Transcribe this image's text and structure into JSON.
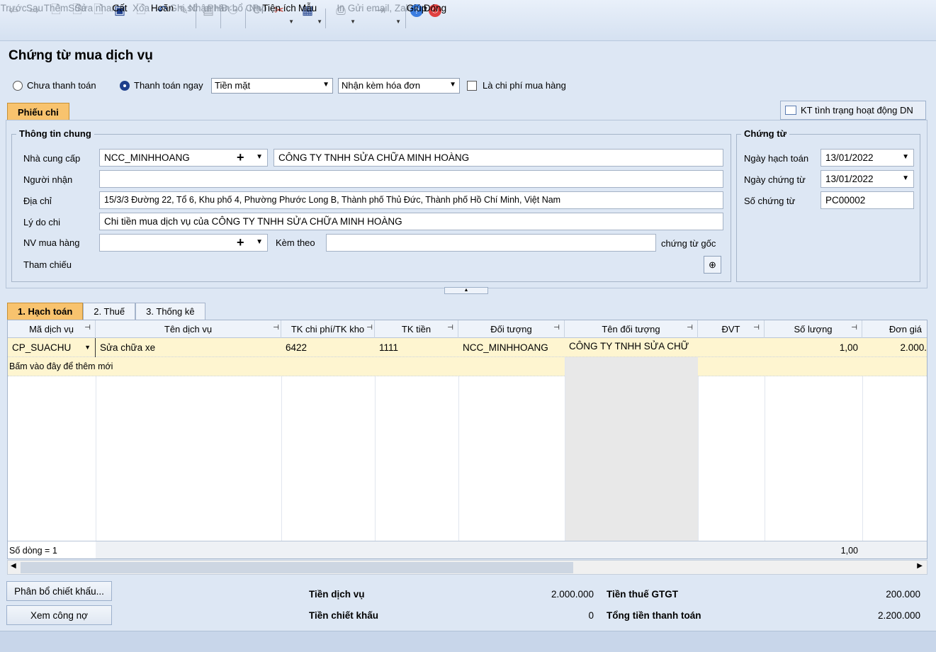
{
  "toolbar": {
    "buttons": [
      {
        "label": "Trước",
        "icon": "arrow-left-icon"
      },
      {
        "label": "Sau",
        "icon": "arrow-right-icon"
      },
      {
        "label": "Thêm",
        "icon": "add-doc-icon"
      },
      {
        "label": "Sửa",
        "icon": "edit-doc-icon"
      },
      {
        "label": "Sửa nhanh",
        "icon": "quick-edit-icon"
      },
      {
        "label": "Cất",
        "icon": "save-icon"
      },
      {
        "label": "Xóa",
        "icon": "delete-icon"
      },
      {
        "label": "Hoãn",
        "icon": "undo-icon"
      },
      {
        "label": "Ghi sổ",
        "icon": "pen-icon"
      },
      {
        "label": "Nhận HĐ",
        "icon": "invoice-icon"
      },
      {
        "label": "Phân bổ CP",
        "icon": "hierarchy-icon"
      },
      {
        "label": "Nạp",
        "icon": "refresh-icon"
      },
      {
        "label": "Tiện ích",
        "icon": "tools-icon"
      },
      {
        "label": "Mẫu",
        "icon": "template-icon"
      },
      {
        "label": "In",
        "icon": "print-icon"
      },
      {
        "label": "Gửi email, Zalo",
        "icon": "send-icon"
      },
      {
        "label": "Giúp",
        "icon": "help-icon"
      },
      {
        "label": "Đóng",
        "icon": "power-icon"
      }
    ]
  },
  "page_title": "Chứng từ mua dịch vụ",
  "payment": {
    "unpaid_label": "Chưa thanh toán",
    "paynow_label": "Thanh toán ngay",
    "method": "Tiền mặt",
    "invoice_option": "Nhận kèm hóa đơn",
    "expense_label": "Là chi phí mua hàng"
  },
  "tab_phieu_chi": "Phiếu chi",
  "kt_button": "KT tình trạng hoạt động DN",
  "general": {
    "title": "Thông tin chung",
    "supplier_label": "Nhà cung cấp",
    "supplier_code": "NCC_MINHHOANG",
    "supplier_name": "CÔNG TY TNHH SỬA CHỮA MINH HOÀNG",
    "receiver_label": "Người nhận",
    "receiver": "",
    "address_label": "Địa chỉ",
    "address": "15/3/3 Đường 22, Tổ 6, Khu phố 4, Phường Phước Long B, Thành phố Thủ Đức, Thành phố Hồ Chí Minh, Việt Nam",
    "reason_label": "Lý do chi",
    "reason": "Chi tiền mua dịch vụ của CÔNG TY TNHH SỬA CHỮA MINH HOÀNG",
    "buyer_label": "NV mua hàng",
    "buyer": "",
    "attach_label": "Kèm theo",
    "attach": "",
    "attach_suffix": "chứng từ gốc",
    "ref_label": "Tham chiếu"
  },
  "voucher": {
    "title": "Chứng từ",
    "posting_date_label": "Ngày hạch toán",
    "posting_date": "13/01/2022",
    "voucher_date_label": "Ngày chứng từ",
    "voucher_date": "13/01/2022",
    "number_label": "Số chứng từ",
    "number": "PC00002"
  },
  "grid_tabs": [
    "1. Hạch toán",
    "2. Thuế",
    "3. Thống kê"
  ],
  "grid": {
    "columns": [
      "Mã dịch vụ",
      "Tên dịch vụ",
      "TK chi phí/TK kho",
      "TK tiền",
      "Đối tượng",
      "Tên đối tượng",
      "ĐVT",
      "Số lượng",
      "Đơn giá"
    ],
    "rows": [
      {
        "code": "CP_SUACHU",
        "name": "Sửa chữa xe",
        "tk_cp": "6422",
        "tk_tien": "1111",
        "doi_tuong": "NCC_MINHHOANG",
        "ten_doi_tuong": "CÔNG TY TNHH SỬA CHỮ",
        "dvt": "",
        "so_luong": "1,00",
        "don_gia": "2.000."
      }
    ],
    "add_new": "Bấm vào đây để thêm mới",
    "row_count": "Số dòng = 1",
    "total_qty": "1,00"
  },
  "buttons": {
    "discount": "Phân bổ chiết khấu...",
    "debt": "Xem công nợ"
  },
  "summary": {
    "service_label": "Tiền dịch vụ",
    "service": "2.000.000",
    "discount_label": "Tiền chiết khấu",
    "discount": "0",
    "vat_label": "Tiền thuế GTGT",
    "vat": "200.000",
    "total_label": "Tổng tiền thanh toán",
    "total": "2.200.000"
  }
}
